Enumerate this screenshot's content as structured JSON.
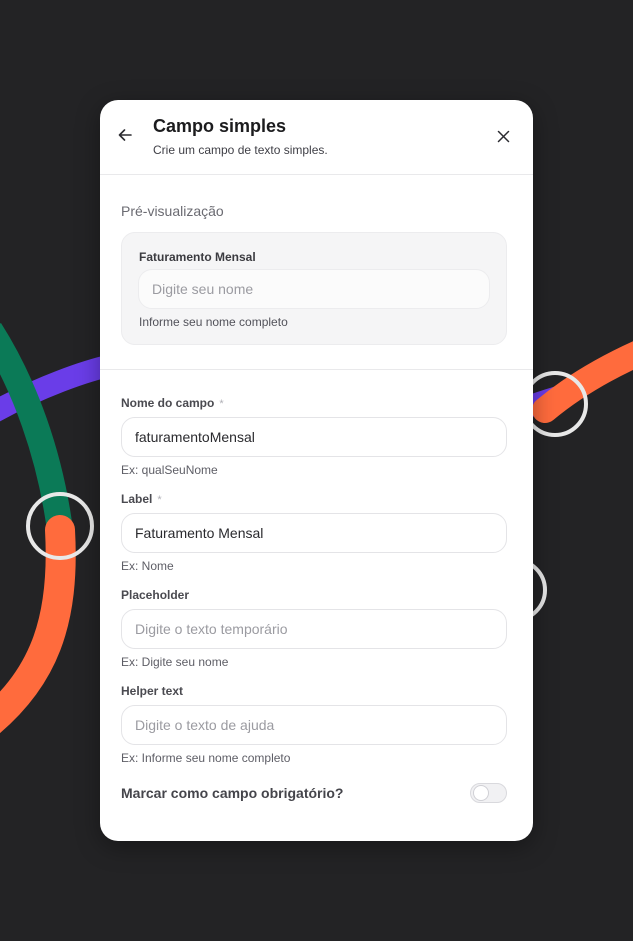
{
  "modal": {
    "title": "Campo simples",
    "subtitle": "Crie um campo de texto simples."
  },
  "preview": {
    "heading": "Pré-visualização",
    "label": "Faturamento Mensal",
    "placeholder": "Digite seu nome",
    "helper": "Informe seu nome completo"
  },
  "form": {
    "name_field": {
      "label": "Nome do campo",
      "required_mark": "*",
      "value": "faturamentoMensal",
      "hint": "Ex: qualSeuNome"
    },
    "label_field": {
      "label": "Label",
      "required_mark": "*",
      "value": "Faturamento Mensal",
      "hint": "Ex: Nome"
    },
    "placeholder_field": {
      "label": "Placeholder",
      "placeholder": "Digite o texto temporário",
      "hint": "Ex: Digite seu nome"
    },
    "helper_field": {
      "label": "Helper text",
      "placeholder": "Digite o texto de ajuda",
      "hint": "Ex: Informe seu nome completo"
    },
    "required_toggle": {
      "label": "Marcar como campo obrigatório?",
      "checked": false
    }
  },
  "icons": {
    "back": "arrow-left-icon",
    "close": "close-icon"
  },
  "colors": {
    "background": "#232325",
    "purple": "#6a3de8",
    "green": "#0b7a57",
    "orange": "#ff6b3d",
    "ring": "#e8e8e8"
  }
}
